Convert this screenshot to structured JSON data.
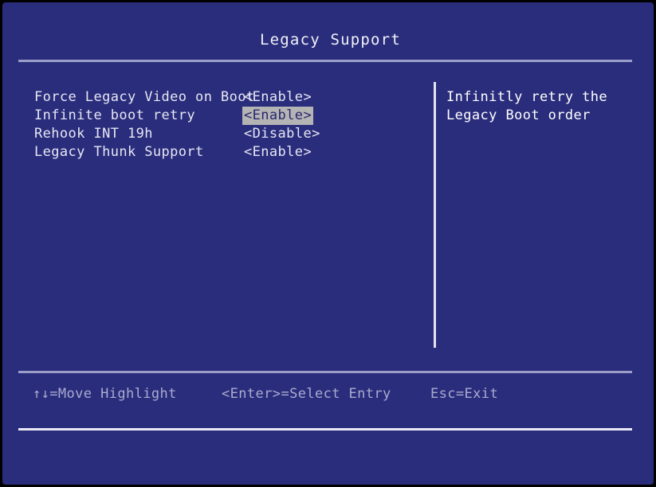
{
  "screen": {
    "title": "Legacy Support",
    "background_color": "#2a2d7c",
    "text_color": "#e6e6f2",
    "highlight_bg_color": "#b4b4b4",
    "highlight_text_color": "#26286e",
    "rule_color": "#9a9dc8",
    "footer_text_color": "#a9abcf"
  },
  "menu": {
    "items": [
      {
        "label": "Force Legacy Video on Boot",
        "value": "<Enable>",
        "selected": false
      },
      {
        "label": "Infinite boot retry",
        "value": "<Enable>",
        "selected": true
      },
      {
        "label": "Rehook INT 19h",
        "value": "<Disable>",
        "selected": false
      },
      {
        "label": "Legacy Thunk Support",
        "value": "<Enable>",
        "selected": false
      }
    ]
  },
  "help": {
    "lines": [
      "Infinitly retry the",
      "Legacy Boot order"
    ]
  },
  "footer": {
    "hints": [
      "↑↓=Move Highlight",
      "<Enter>=Select Entry",
      "Esc=Exit"
    ]
  }
}
